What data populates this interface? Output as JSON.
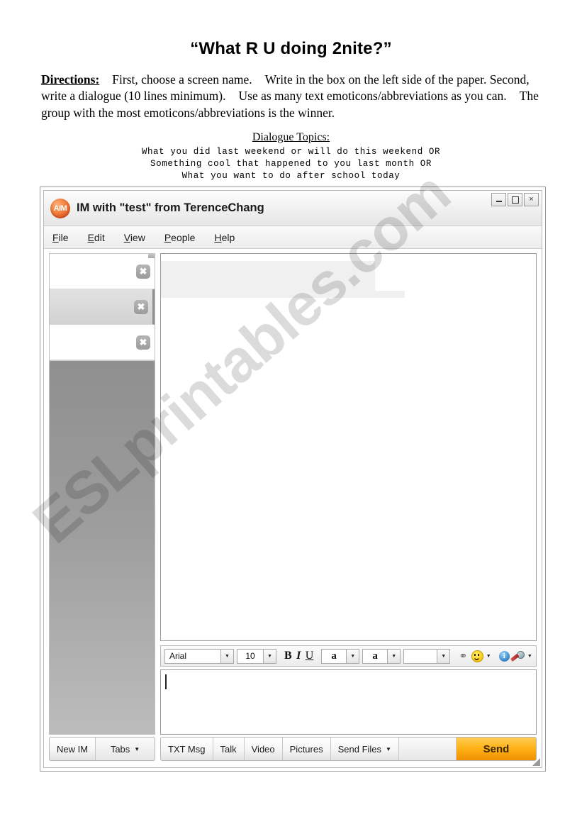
{
  "worksheet": {
    "title": "“What R U doing 2nite?”",
    "directions_label": "Directions:",
    "directions_line1a": "First, choose a screen name.",
    "directions_line1b": "Write in the box on the left side of the paper.",
    "directions_line2a": "Second, write a dialogue (10 lines minimum).",
    "directions_line2b": "Use as many text emoticons/abbreviations",
    "directions_line3": "as you can.",
    "directions_line3b": "The group with the most emoticons/abbreviations is the winner.",
    "topics_heading": "Dialogue Topics:",
    "topics": [
      "What you did last weekend or will do this weekend OR",
      "Something cool that happened to you last month OR",
      "What you want to do after school today"
    ]
  },
  "watermark": {
    "text": "ESLprintables.com"
  },
  "aim": {
    "logo_text": "AIM",
    "title": "IM with \"test\" from TerenceChang",
    "window_controls": {
      "minimize": "minimize-icon",
      "maximize": "maximize-icon",
      "close": "×"
    },
    "menu": [
      {
        "prefix": "",
        "accel": "F",
        "suffix": "ile"
      },
      {
        "prefix": "",
        "accel": "E",
        "suffix": "dit"
      },
      {
        "prefix": "",
        "accel": "V",
        "suffix": "iew"
      },
      {
        "prefix": "",
        "accel": "P",
        "suffix": "eople"
      },
      {
        "prefix": "",
        "accel": "H",
        "suffix": "elp"
      }
    ],
    "sidebar": {
      "tabs": [
        {
          "label": "",
          "selected": false,
          "close": "✖"
        },
        {
          "label": "",
          "selected": true,
          "close": "✖"
        },
        {
          "label": "",
          "selected": false,
          "close": "✖"
        }
      ]
    },
    "message_area": {
      "content": ""
    },
    "format_toolbar": {
      "font_family": "Arial",
      "font_size": "10",
      "bold": "B",
      "italic": "I",
      "underline": "U",
      "text_color_glyph": "a",
      "highlight_color_glyph": "a",
      "background_color_glyph": "",
      "link_icon": "⚭",
      "smiley_icon": "smiley-icon",
      "info_icon": "i",
      "voice_icon": "microphone-icon",
      "caret_down": "▼"
    },
    "compose": {
      "value": "",
      "placeholder": ""
    },
    "bottom_bar": {
      "left_buttons": [
        {
          "label": "New IM",
          "caret": ""
        },
        {
          "label": "Tabs",
          "caret": "▼"
        }
      ],
      "right_buttons": [
        {
          "label": "TXT Msg",
          "caret": ""
        },
        {
          "label": "Talk",
          "caret": ""
        },
        {
          "label": "Video",
          "caret": ""
        },
        {
          "label": "Pictures",
          "caret": ""
        },
        {
          "label": "Send Files",
          "caret": "▼"
        }
      ],
      "send_label": "Send"
    },
    "colors": {
      "send_button": "#ffb319",
      "logo": "#f37f3c",
      "titlebar": "#f2f2f2",
      "sidebar_fill": "#9d9d9d"
    }
  }
}
